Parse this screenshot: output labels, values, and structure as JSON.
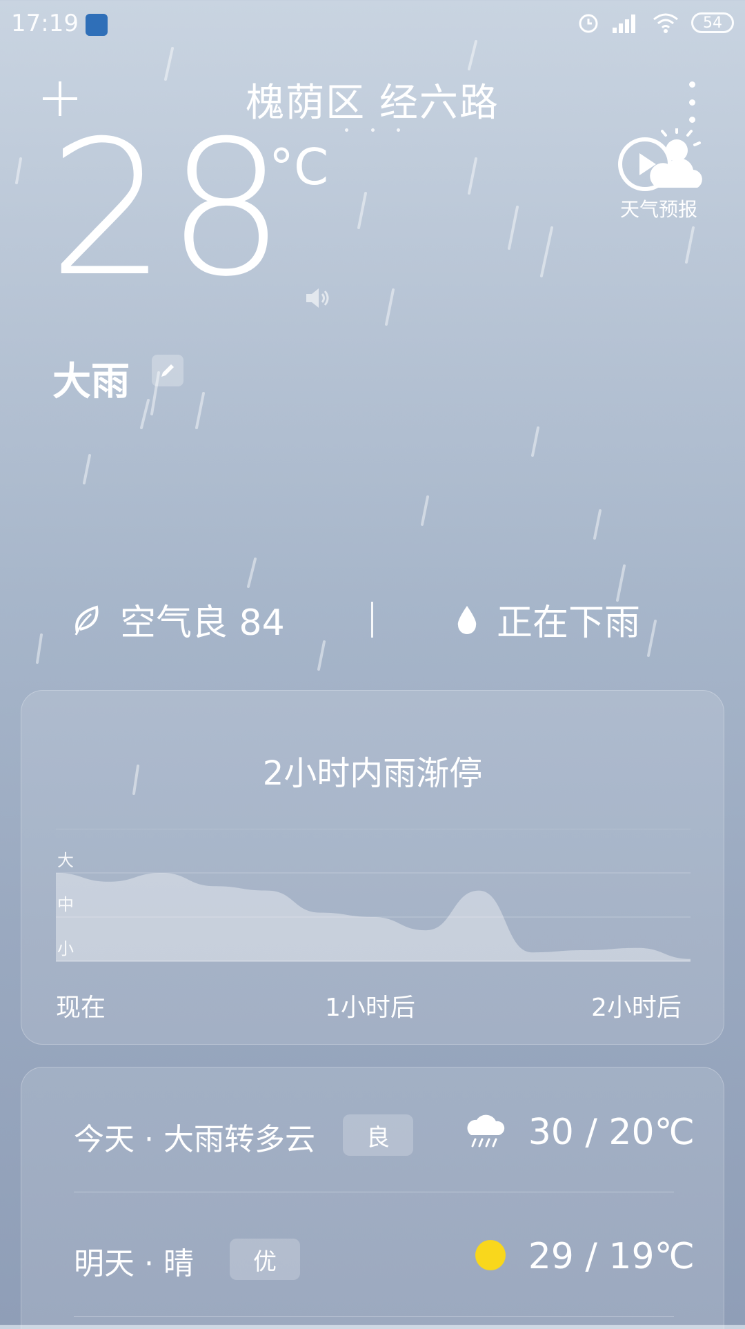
{
  "status_bar": {
    "time": "17:19",
    "battery": "54"
  },
  "header": {
    "location": "槐荫区 经六路"
  },
  "current": {
    "temperature": "28",
    "unit": "°C",
    "condition": "大雨",
    "forecast_video_label": "天气预报"
  },
  "air": {
    "quality": "空气良 84",
    "precip_status": "正在下雨"
  },
  "rain_card": {
    "title": "2小时内雨渐停",
    "y_labels": [
      "大",
      "中",
      "小"
    ],
    "x_labels": [
      "现在",
      "1小时后",
      "2小时后"
    ]
  },
  "chart_data": {
    "type": "area",
    "x": [
      0,
      10,
      20,
      30,
      40,
      50,
      60,
      70,
      80,
      90,
      100,
      110,
      120
    ],
    "values": [
      2.0,
      1.8,
      2.0,
      1.7,
      1.6,
      1.1,
      1.0,
      0.7,
      1.6,
      0.2,
      0.25,
      0.3,
      0.05
    ],
    "ylim": [
      0,
      3
    ],
    "x_ticks": [
      "现在",
      "1小时后",
      "2小时后"
    ],
    "y_ticks": [
      "小",
      "中",
      "大"
    ]
  },
  "daily": [
    {
      "day": "今天 · 大雨转多云",
      "aqi": "良",
      "icon": "rain-cloud-icon",
      "temps": "30 / 20℃"
    },
    {
      "day": "明天 · 晴",
      "aqi": "优",
      "icon": "sun-icon",
      "temps": "29 / 19℃"
    }
  ],
  "colors": {
    "sun": "#f9d71c"
  }
}
